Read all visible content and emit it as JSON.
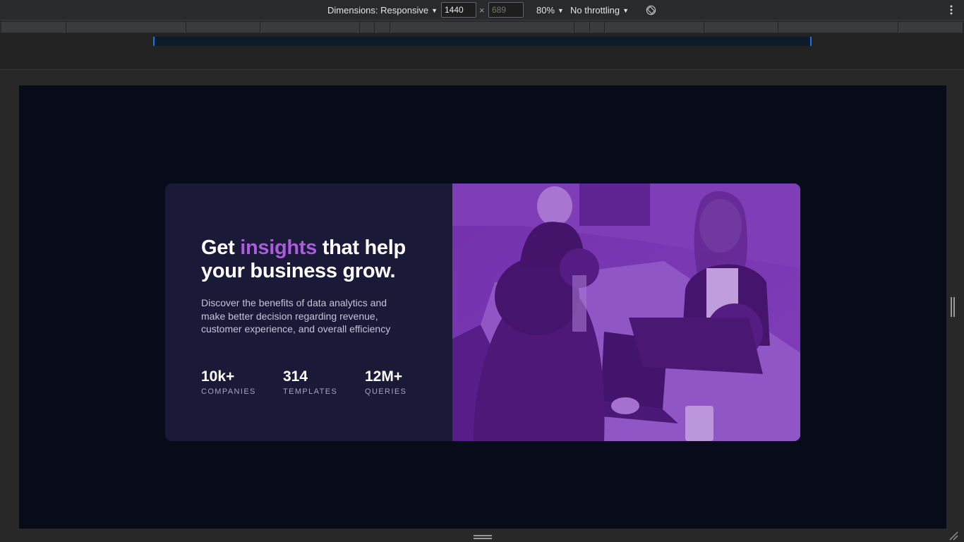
{
  "toolbar": {
    "dimensions_label": "Dimensions: Responsive",
    "width_value": "1440",
    "height_placeholder": "689",
    "times": "×",
    "zoom": "80%",
    "throttling": "No throttling",
    "rotate_icon": "rotate-icon",
    "menu_icon": "more-vertical-icon"
  },
  "card": {
    "title_prefix": "Get ",
    "title_accent": "insights",
    "title_suffix": " that help your business grow.",
    "description": "Discover the benefits of data analytics and make better decision regarding revenue, customer experience, and overall efficiency",
    "stats": [
      {
        "value": "10k+",
        "label": "COMPANIES"
      },
      {
        "value": "314",
        "label": "TEMPLATES"
      },
      {
        "value": "12M+",
        "label": "QUERIES"
      }
    ],
    "image_icon": "team-working-photo"
  },
  "colors": {
    "page_bg": "#080b1a",
    "card_bg": "#1b1938",
    "accent": "#aa5cdb",
    "image_tint": "#6b2f9e"
  }
}
